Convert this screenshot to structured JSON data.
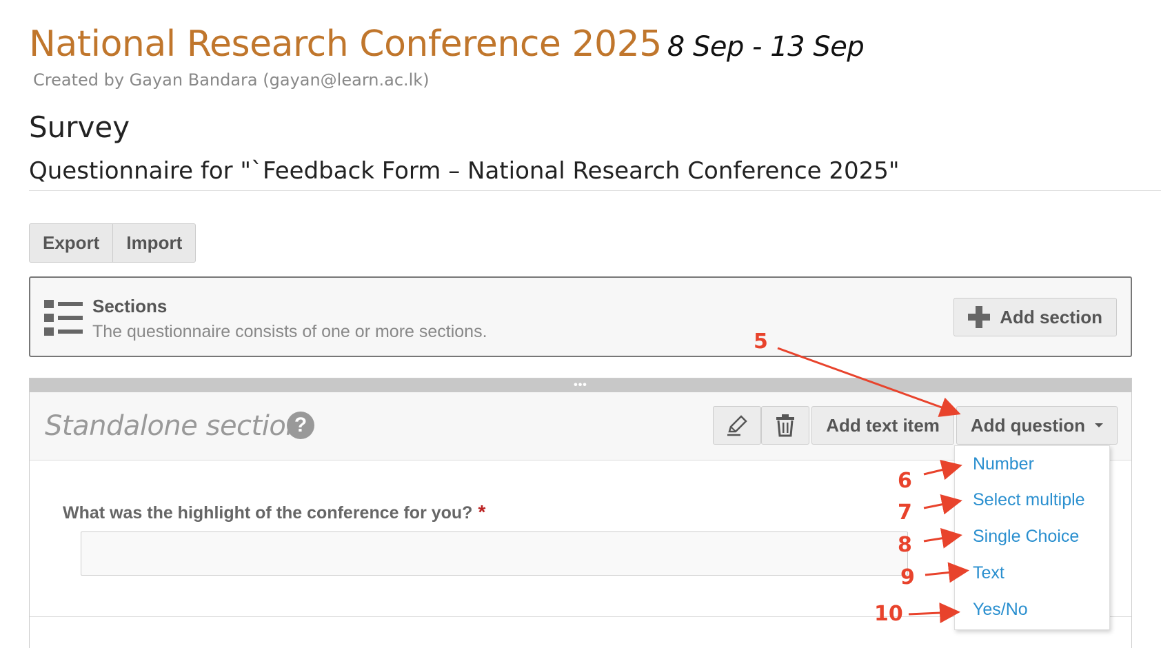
{
  "header": {
    "conference_title": "National Research Conference 2025",
    "dates": "8 Sep - 13 Sep",
    "created_by": "Created by Gayan Bandara (gayan@learn.ac.lk)",
    "page_heading": "Survey",
    "questionnaire_title": "Questionnaire for \"`Feedback Form – National Research Conference 2025\""
  },
  "toolbar": {
    "export_label": "Export",
    "import_label": "Import"
  },
  "sections_box": {
    "icon": "list-icon",
    "title": "Sections",
    "description": "The questionnaire consists of one or more sections.",
    "add_section_label": "Add section"
  },
  "section": {
    "name": "Standalone section",
    "help_icon_glyph": "?",
    "drag_handle": "•••",
    "edit_icon": "pencil-icon",
    "delete_icon": "trash-icon",
    "add_text_item_label": "Add text item",
    "add_question_label": "Add question"
  },
  "question": {
    "label": "What was the highlight of the conference for you?",
    "required_mark": "*",
    "answer_value": ""
  },
  "add_question_menu": {
    "options": [
      "Number",
      "Select multiple",
      "Single Choice",
      "Text",
      "Yes/No"
    ]
  },
  "annotations": {
    "steps": [
      "5",
      "6",
      "7",
      "8",
      "9",
      "10"
    ],
    "color": "#e8432c"
  },
  "colors": {
    "title_accent": "#c0762c",
    "link_blue": "#2a8fcf",
    "required_red": "#b22222"
  }
}
